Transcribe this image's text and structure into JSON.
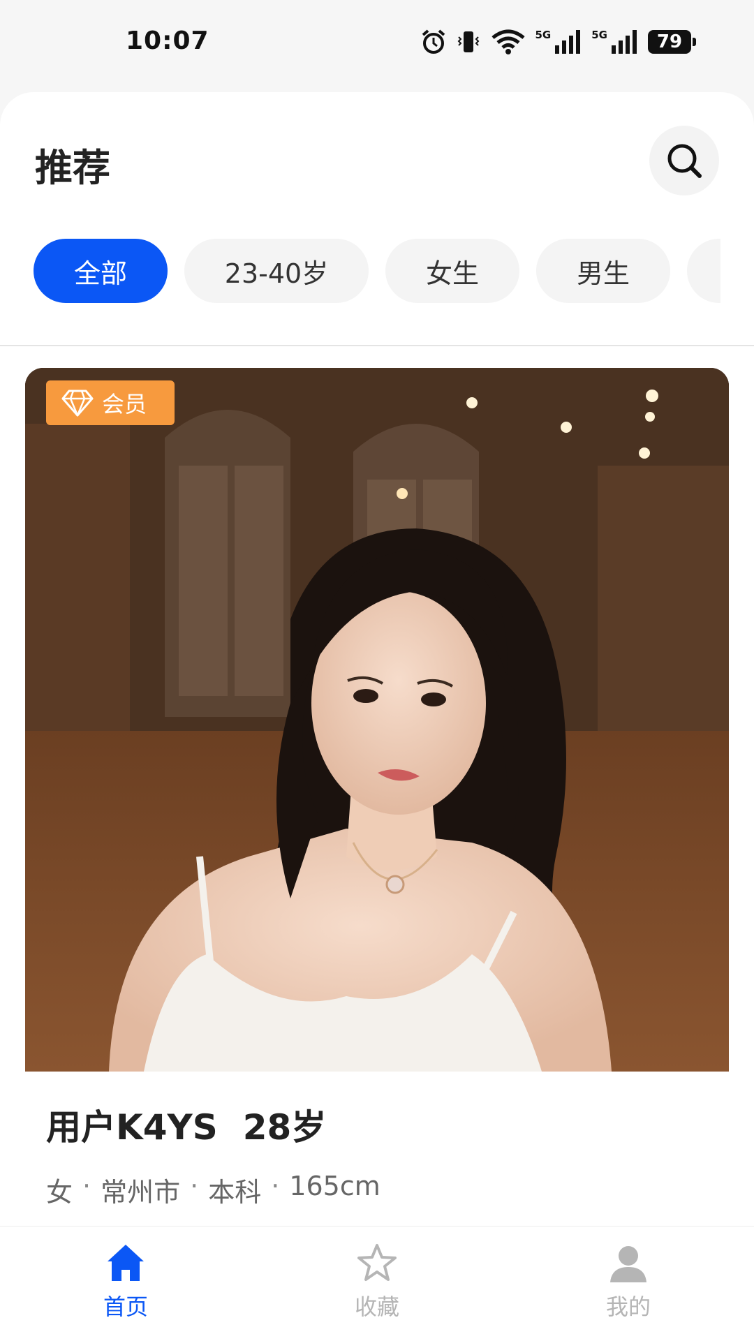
{
  "status_bar": {
    "time": "10:07",
    "network_1": "5G",
    "network_2": "5G",
    "battery": "79",
    "icons": [
      "alarm-icon",
      "vibrate-icon",
      "wifi-icon",
      "signal-icon",
      "signal-icon",
      "battery-icon"
    ]
  },
  "header": {
    "title": "推荐",
    "search_icon": "search-icon"
  },
  "filters": {
    "chips": [
      {
        "label": "全部",
        "active": true
      },
      {
        "label": "23-40岁",
        "active": false
      },
      {
        "label": "女生",
        "active": false
      },
      {
        "label": "男生",
        "active": false
      },
      {
        "label": "",
        "active": false
      }
    ]
  },
  "card": {
    "badge_label": "会员",
    "badge_icon": "diamond-icon",
    "name": "用户K4YS",
    "age": "28岁",
    "meta": [
      "女",
      "常州市",
      "本科",
      "165cm"
    ],
    "separator": "·"
  },
  "bottom_nav": {
    "items": [
      {
        "label": "首页",
        "icon": "home-icon",
        "active": true
      },
      {
        "label": "收藏",
        "icon": "star-icon",
        "active": false
      },
      {
        "label": "我的",
        "icon": "user-icon",
        "active": false
      }
    ]
  },
  "colors": {
    "accent": "#0b57f5",
    "badge": "#f79a3e",
    "chip_bg": "#f4f4f4"
  }
}
